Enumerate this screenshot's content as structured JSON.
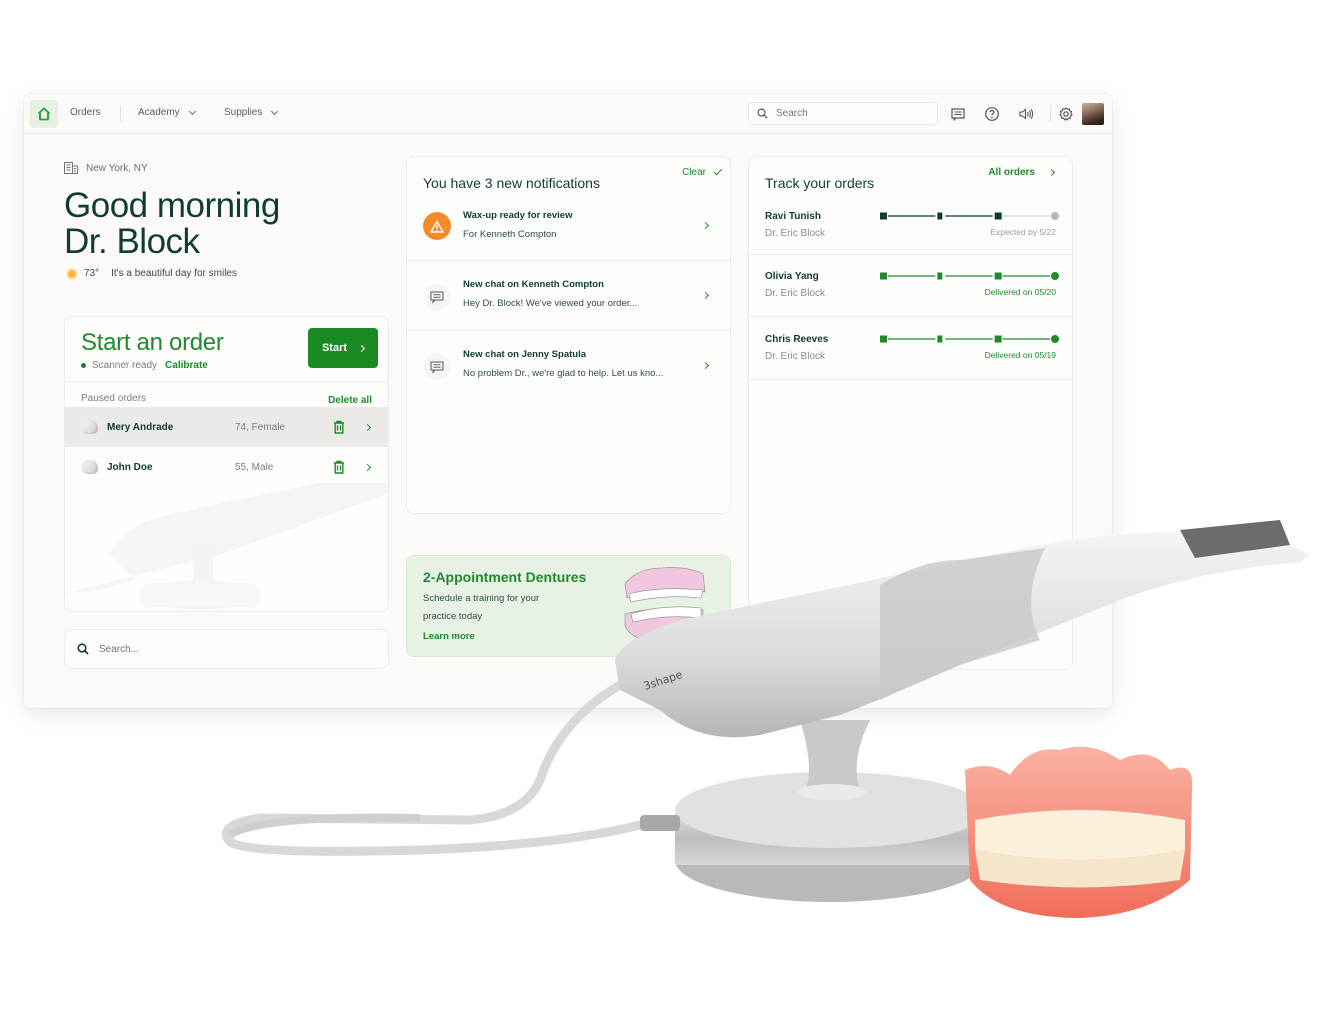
{
  "nav": {
    "home_icon": "house-icon",
    "items": [
      {
        "label": "Orders",
        "has_dropdown": false
      },
      {
        "label": "Academy",
        "has_dropdown": true
      },
      {
        "label": "Supplies",
        "has_dropdown": true
      }
    ],
    "search_placeholder": "Search",
    "icons": [
      "chat-icon",
      "help-icon",
      "sound-icon",
      "gear-icon"
    ],
    "avatar": "user-avatar"
  },
  "welcome": {
    "location": "New York, NY",
    "greeting_line1": "Good morning",
    "greeting_line2": "Dr. Block",
    "temperature": "73°",
    "weather_text": "It's a beautiful day for smiles"
  },
  "start_order": {
    "title": "Start an order",
    "scanner_status": "Scanner ready",
    "calibrate_label": "Calibrate",
    "start_label": "Start",
    "paused_label": "Paused orders",
    "delete_all_label": "Delete all",
    "paused_orders": [
      {
        "name": "Mery Andrade",
        "info": "74, Female",
        "highlighted": true
      },
      {
        "name": "John Doe",
        "info": "55, Male",
        "highlighted": false
      }
    ]
  },
  "bottom_search": {
    "placeholder": "Search..."
  },
  "notifications": {
    "title": "You have 3 new notifications",
    "clear_label": "Clear",
    "items": [
      {
        "type": "warning",
        "title": "Wax-up ready for review",
        "subtitle": "For Kenneth Compton"
      },
      {
        "type": "chat",
        "title": "New chat on Kenneth Compton",
        "subtitle": "Hey Dr. Block! We've viewed your order..."
      },
      {
        "type": "chat",
        "title": "New chat on Jenny Spatula",
        "subtitle": "No problem Dr., we're glad to help. Let us kno..."
      }
    ]
  },
  "promo": {
    "title": "2-Appointment Dentures",
    "text": "Schedule a training for your practice today",
    "link": "Learn more"
  },
  "tracking": {
    "title": "Track your orders",
    "all_orders_label": "All orders",
    "orders": [
      {
        "name": "Ravi Tunish",
        "doctor": "Dr. Eric Block",
        "status": "Expected by 5/22",
        "steps_complete": 3,
        "steps_total": 4,
        "delivered": false
      },
      {
        "name": "Olivia Yang",
        "doctor": "Dr. Eric Block",
        "status": "Delivered on 05/20",
        "steps_complete": 4,
        "steps_total": 4,
        "delivered": true
      },
      {
        "name": "Chris Reeves",
        "doctor": "Dr. Eric Block",
        "status": "Delivered on 05/19",
        "steps_complete": 4,
        "steps_total": 4,
        "delivered": true
      }
    ]
  },
  "product": {
    "brand_label": "3shape"
  },
  "colors": {
    "brand_green": "#1f8a2c",
    "dark_green": "#0f3e2e",
    "warning_orange": "#f48a2a",
    "promo_bg": "#e7f1e4"
  }
}
